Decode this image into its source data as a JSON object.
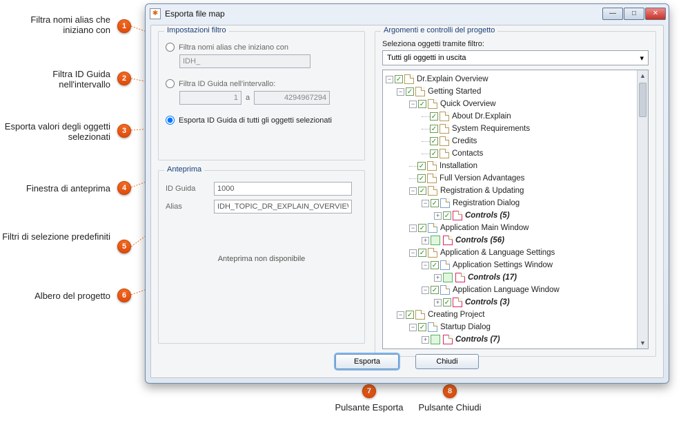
{
  "annotations": {
    "a1": "Filtra nomi alias che iniziano con",
    "a2": "Filtra ID Guida nell'intervallo",
    "a3": "Esporta valori degli oggetti selezionati",
    "a4": "Finestra di anteprima",
    "a5": "Filtri di selezione predefiniti",
    "a6": "Albero del progetto",
    "a7": "Pulsante Esporta",
    "a8": "Pulsante Chiudi"
  },
  "badges": {
    "n1": "1",
    "n2": "2",
    "n3": "3",
    "n4": "4",
    "n5": "5",
    "n6": "6",
    "n7": "7",
    "n8": "8"
  },
  "window": {
    "title": "Esporta file map",
    "min": "—",
    "max": "□",
    "close": "✕"
  },
  "filter": {
    "group_title": "Impostazioni filtro",
    "radio_alias": "Filtra nomi alias che iniziano con",
    "alias_value": "IDH_",
    "radio_range": "Filtra ID Guida nell'intervallo:",
    "range_from": "1",
    "range_sep": "a",
    "range_to": "4294967294",
    "radio_export": "Esporta ID Guida di tutti gli oggetti selezionati"
  },
  "preview": {
    "group_title": "Anteprima",
    "idguida_label": "ID Guida",
    "idguida_value": "1000",
    "alias_label": "Alias",
    "alias_value": "IDH_TOPIC_DR_EXPLAIN_OVERVIEW",
    "not_available": "Anteprima non disponibile"
  },
  "right": {
    "group_title": "Argomenti e controlli del progetto",
    "combo_label": "Seleziona oggetti tramite filtro:",
    "combo_value": "Tutti gli oggetti in uscita",
    "combo_arrow": "▾"
  },
  "tree": {
    "n0": "Dr.Explain Overview",
    "n1": "Getting Started",
    "n2": "Quick Overview",
    "n3": "About Dr.Explain",
    "n4": "System Requirements",
    "n5": "Credits",
    "n6": "Contacts",
    "n7": "Installation",
    "n8": "Full Version Advantages",
    "n9": "Registration & Updating",
    "n10": "Registration Dialog",
    "n11": "Controls (5)",
    "n12": "Application Main Window",
    "n13": "Controls (56)",
    "n14": "Application & Language Settings",
    "n15": "Application Settings Window",
    "n16": "Controls (17)",
    "n17": "Application Language Window",
    "n18": "Controls (3)",
    "n19": "Creating Project",
    "n20": "Startup Dialog",
    "n21": "Controls (7)"
  },
  "buttons": {
    "export": "Esporta",
    "close": "Chiudi"
  }
}
